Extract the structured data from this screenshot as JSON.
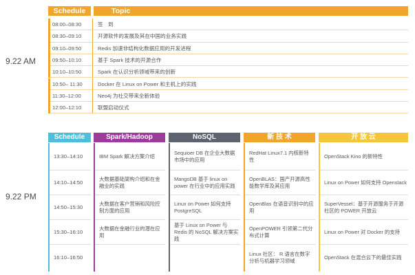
{
  "am": {
    "day_label": "9.22 AM",
    "header": {
      "schedule": "Schedule",
      "topic": "Topic"
    },
    "rows": [
      {
        "time": "08:00–08:30",
        "topic": "签　到"
      },
      {
        "time": "08:30–09:10",
        "topic": "开源软件的发展及其在中国的业务实践"
      },
      {
        "time": "09:10–09:50",
        "topic": "Redis 加速非结构化数据应用的开发进程"
      },
      {
        "time": "09:50–10:10",
        "topic": "基于 Spark 技术的开源合作"
      },
      {
        "time": "10:10–10:50",
        "topic": "Spark 在认识分析领域带来的创新"
      },
      {
        "time": "10:50– 11:30",
        "topic": "Docker 在 Linux on Power 和主机上的实践"
      },
      {
        "time": "11:30–12:00",
        "topic": "Neo4j 为社交带来全新体验"
      },
      {
        "time": "12:00–12:10",
        "topic": "联盟启动仪式"
      }
    ]
  },
  "pm": {
    "day_label": "9.22 PM",
    "header": {
      "schedule": "Schedule",
      "spark": "Spark/Hadoop",
      "nosql": "NoSQL",
      "tech": "新 技 术",
      "cloud": "开 放 云"
    },
    "rows": [
      {
        "time": "13:30–14:10",
        "spark": "IBM Spark 解决方案介绍",
        "nosql": "Sequioer DB 在企业大数据市场中的应用",
        "tech": "RedHat Linux7.1 内核新特性",
        "cloud": "OpenStack Kino 的新特性"
      },
      {
        "time": "14:10–14:50",
        "spark": "大数据基础架构介绍和在金融业的实践",
        "nosql": "MangoDB 基于 linux on power 在行业中的应用实践",
        "tech": "OpenBLAS：国产开源高性能数学库及其应用",
        "cloud": "Linux on Power 如何支持 Openstack"
      },
      {
        "time": "14:50–15:30",
        "spark": "大数据在客户营销和风险控制方面的应用",
        "nosql": "Linux on Power 如何支持 PostgreSQL",
        "tech": "OpenBlas 在语音识别中的应用",
        "cloud": "SuperVessel：基于开源服务于开源社区的 POWER 开放云"
      },
      {
        "time": "15:30–16:10",
        "spark": "大数据在金融行业的潜在应用",
        "nosql": "基于 Linux on Power 与 Redis 的 NoSQL 解决方案实践",
        "tech": "OpenPOWER 引领第二代分布式计算",
        "cloud": "Linux on Power 对 Docker 的支持"
      },
      {
        "time": "16:10–16:50",
        "spark": "",
        "nosql": "",
        "tech": "Linux 社区： R 语言在数字分析与机器学习领域",
        "cloud": "OpenStack 在混合云下的最佳实践"
      }
    ]
  },
  "colors": {
    "am_accent": "#f2a52b",
    "schedule": "#4dbfd8",
    "spark": "#9b3c9b",
    "nosql": "#5d6470",
    "tech": "#f2a52b",
    "cloud": "#f6c63a"
  }
}
